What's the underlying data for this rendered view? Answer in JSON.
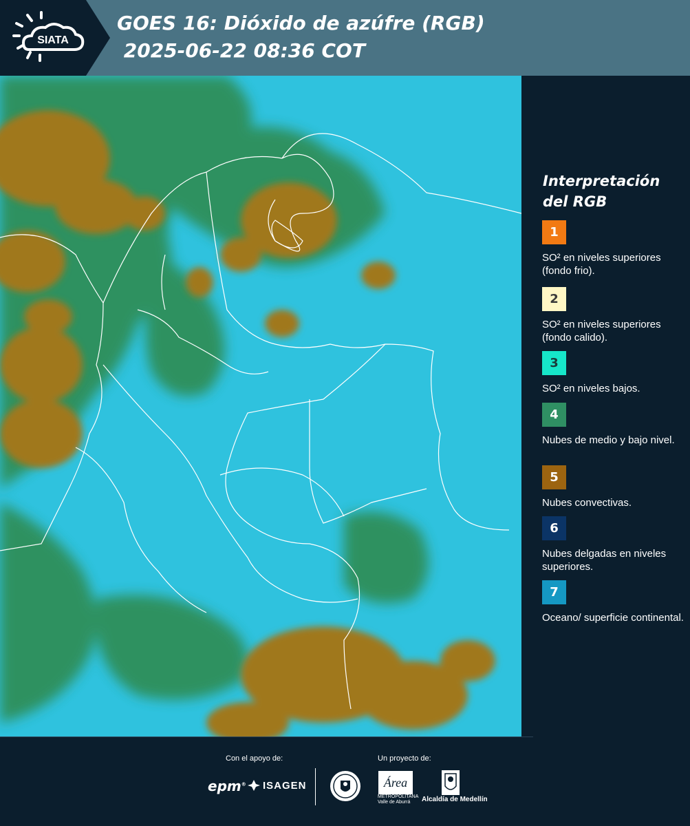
{
  "header": {
    "logo_text": "SIATA",
    "title": "GOES 16: Dióxido de azúfre (RGB)\n 2025-06-22 08:36 COT",
    "logo_bg": "#0b1e2d",
    "bar_bg": "#4a7384"
  },
  "legend": {
    "title": "Interpretación del RGB",
    "items": [
      {
        "number": "1",
        "color": "#f27a13",
        "text_color": "#ffffff",
        "label": "SO² en niveles superiores (fondo frio)."
      },
      {
        "number": "2",
        "color": "#fff7c5",
        "text_color": "#3a3a3a",
        "label": "SO² en niveles superiores (fondo calido)."
      },
      {
        "number": "3",
        "color": "#16e6c9",
        "text_color": "#1a3a3a",
        "label": "SO² en niveles bajos."
      },
      {
        "number": "4",
        "color": "#2f8f63",
        "text_color": "#ffffff",
        "label": "Nubes de medio y bajo nivel."
      },
      {
        "number": "5",
        "color": "#9c6410",
        "text_color": "#ffffff",
        "label": "Nubes convectivas."
      },
      {
        "number": "6",
        "color": "#0b3466",
        "text_color": "#ffffff",
        "label": "Nubes delgadas en niveles superiores."
      },
      {
        "number": "7",
        "color": "#1598c3",
        "text_color": "#ffffff",
        "label": "Oceano/ superficie continental."
      }
    ]
  },
  "footer": {
    "support_label": "Con el apoyo de:",
    "project_label": "Un proyecto de:",
    "sponsors": [
      "epm",
      "ISAGEN"
    ],
    "area_logo_text": "Área",
    "area_name": "METROPOLITANA Valle de Aburrá",
    "alcaldia_name": "Alcaldía de Medellín"
  },
  "map": {
    "colors": {
      "ocean": "#2fc2de",
      "convective": "#a0781e",
      "mid_low": "#2f8c52",
      "border": "#ffffff"
    }
  }
}
